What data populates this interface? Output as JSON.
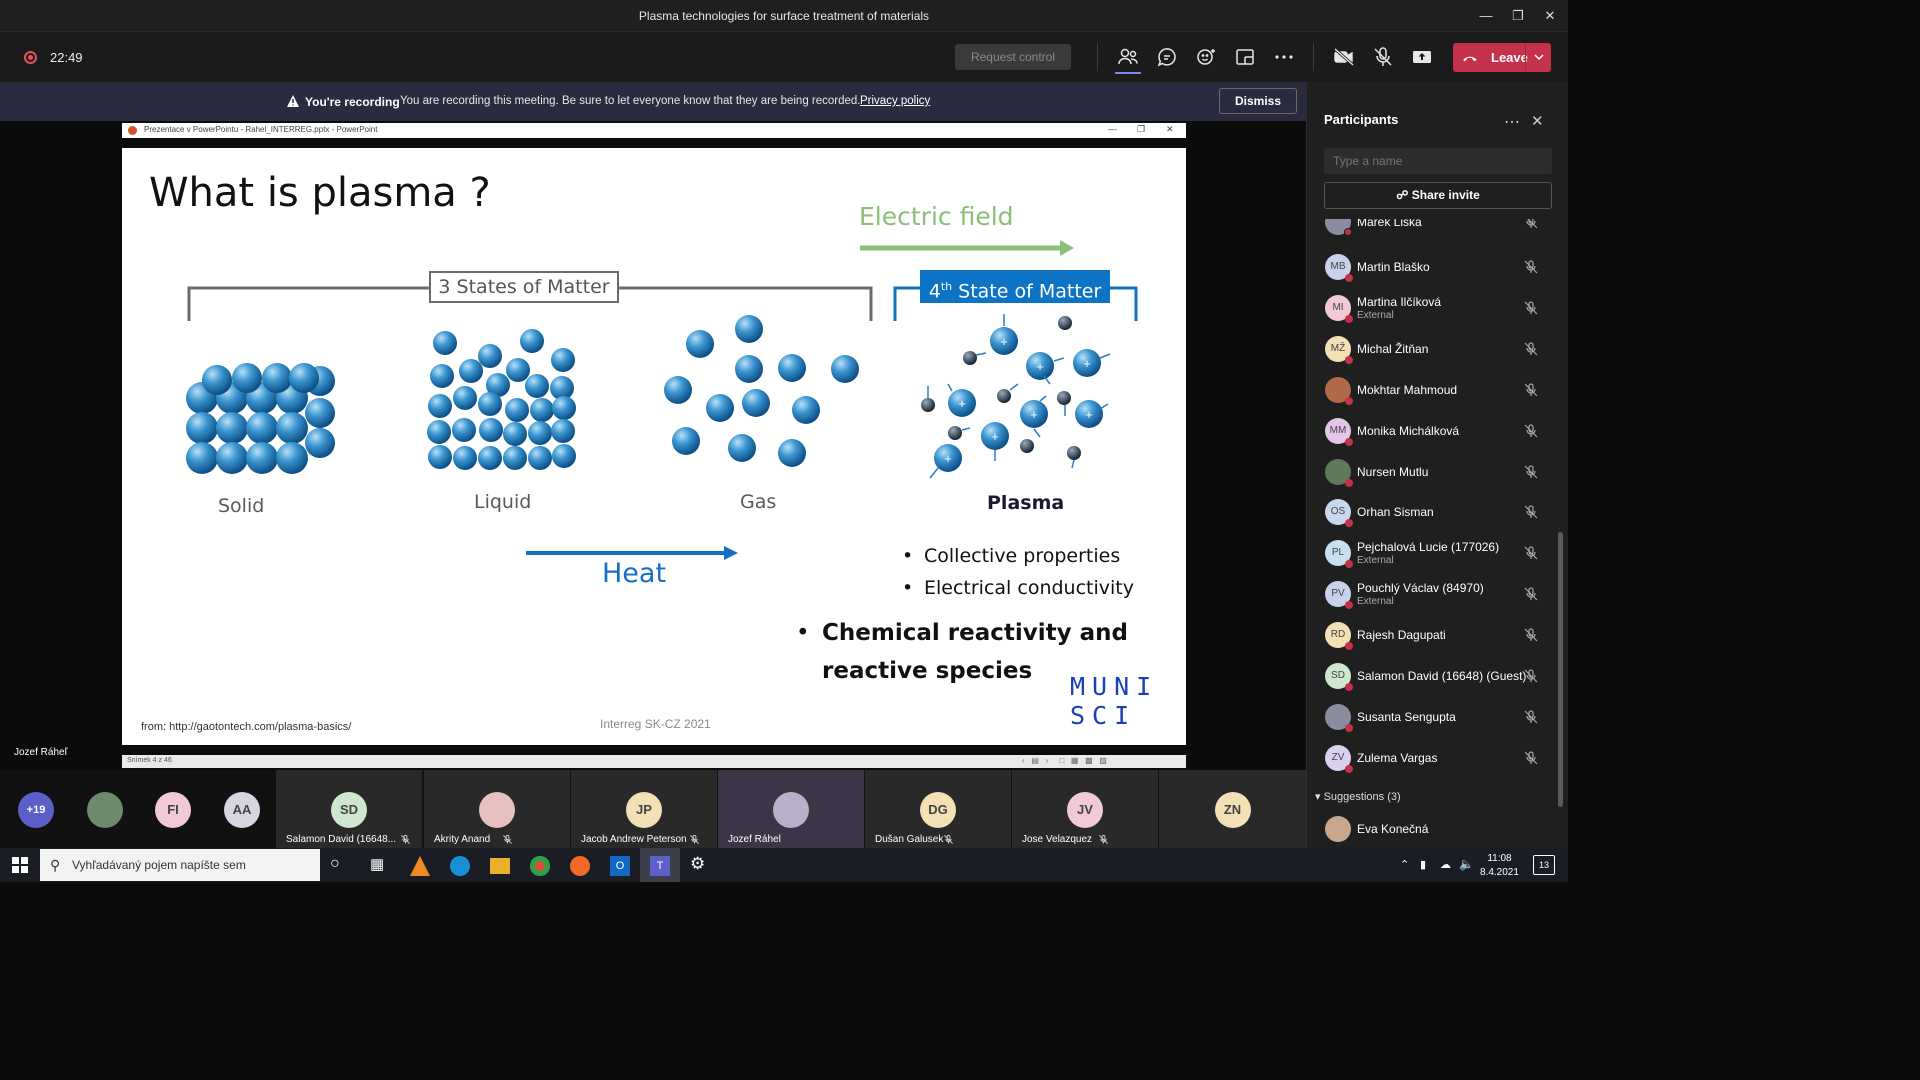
{
  "window": {
    "title": "Plasma technologies for surface treatment of materials"
  },
  "toolbar": {
    "timer": "22:49",
    "request_control": "Request control",
    "leave": "Leave"
  },
  "banner": {
    "strong": "You're recording",
    "message": "You are recording this meeting. Be sure to let everyone know that they are being recorded.",
    "link": "Privacy policy",
    "dismiss": "Dismiss"
  },
  "ppt": {
    "window_title": "Prezentace v PowerPointu - Rahel_INTERREG.pptx - PowerPoint",
    "status": "Snímek 4 z 46"
  },
  "slide": {
    "title": "What is plasma ?",
    "electric_field": "Electric field",
    "three_states": "3 States of Matter",
    "fourth_sup": "th",
    "fourth_num": "4",
    "fourth_rest": " State of Matter",
    "labels": {
      "solid": "Solid",
      "liquid": "Liquid",
      "gas": "Gas",
      "plasma": "Plasma"
    },
    "heat": "Heat",
    "bullets": [
      "Collective properties",
      "Electrical conductivity"
    ],
    "big_bullet_line1": "Chemical reactivity and",
    "big_bullet_line2": "reactive species",
    "muni_line1": "MUNI",
    "muni_line2": "SCI",
    "source": "from: http://gaotontech.com/plasma-basics/",
    "footer": "Interreg SK-CZ 2021"
  },
  "presenter_name": "Jozef Ráheľ",
  "participants": {
    "title": "Participants",
    "search_placeholder": "Type a name",
    "share_invite": "Share invite",
    "partial_name": "Marek Liska",
    "items": [
      {
        "initials": "MB",
        "name": "Martin Blaško",
        "sub": "",
        "color": "#c9d2ec"
      },
      {
        "initials": "MI",
        "name": "Martina Ilčíková",
        "sub": "External",
        "color": "#f2c9d6"
      },
      {
        "initials": "MŽ",
        "name": "Michal Žitňan",
        "sub": "",
        "color": "#f3e0b5"
      },
      {
        "initials": "",
        "name": "Mokhtar Mahmoud",
        "sub": "",
        "color": "#b06a4a"
      },
      {
        "initials": "MM",
        "name": "Monika Michálková",
        "sub": "",
        "color": "#e3c6e9"
      },
      {
        "initials": "",
        "name": "Nursen Mutlu",
        "sub": "",
        "color": "#5f7a5a"
      },
      {
        "initials": "OS",
        "name": "Orhan Sisman",
        "sub": "",
        "color": "#c9d6ee"
      },
      {
        "initials": "PL",
        "name": "Pejchalová Lucie (177026)",
        "sub": "External",
        "color": "#c9e0ee"
      },
      {
        "initials": "PV",
        "name": "Pouchlý Václav (84970)",
        "sub": "External",
        "color": "#c9d2ec"
      },
      {
        "initials": "RD",
        "name": "Rajesh Dagupati",
        "sub": "",
        "color": "#f3e0b5"
      },
      {
        "initials": "SD",
        "name": "Salamon David (16648) (Guest)",
        "sub": "",
        "color": "#cfe6cf"
      },
      {
        "initials": "",
        "name": "Susanta Sengupta",
        "sub": "",
        "color": "#8c8ca0"
      },
      {
        "initials": "ZV",
        "name": "Zulema Vargas",
        "sub": "",
        "color": "#d9cfee"
      }
    ],
    "suggestions": "Suggestions (3)",
    "suggestion_item": "Eva Konečná"
  },
  "tiles": {
    "more": "+19",
    "fi": "FI",
    "aa": "AA",
    "items": [
      {
        "initials": "SD",
        "name": "Salamon David (16648...",
        "color": "#cfe6cf"
      },
      {
        "initials": "",
        "name": "Akrity Anand",
        "color": "#e8c0c0"
      },
      {
        "initials": "JP",
        "name": "Jacob Andrew Peterson",
        "color": "#f3e0b5"
      },
      {
        "initials": "",
        "name": "Jozef Ráhel",
        "color": "#b7b0c8"
      },
      {
        "initials": "DG",
        "name": "Dušan Galusek",
        "color": "#f3e0b5"
      },
      {
        "initials": "JV",
        "name": "Jose Velazquez",
        "color": "#f2c9d6"
      },
      {
        "initials": "ZN",
        "name": "",
        "color": "#f3e0b5"
      }
    ]
  },
  "taskbar": {
    "search": "Vyhľadávaný pojem napíšte sem",
    "time": "11:08",
    "date": "8.4.2021",
    "notif": "13"
  }
}
